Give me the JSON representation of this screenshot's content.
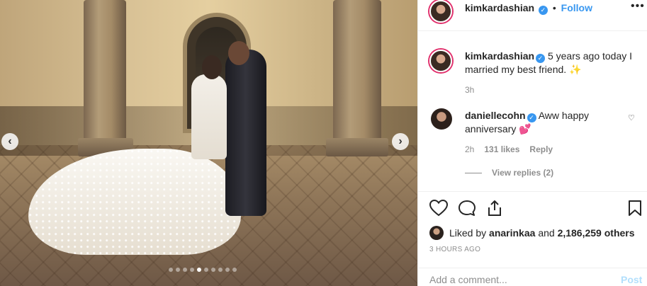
{
  "photo": {
    "prev_icon": "chevron-left-icon",
    "next_icon": "chevron-right-icon",
    "prev_glyph": "‹",
    "next_glyph": "›",
    "carousel_dot_count": 10,
    "active_dot_index": 4
  },
  "header": {
    "username": "kimkardashian",
    "separator": "•",
    "follow_label": "Follow",
    "more_glyph": "•••"
  },
  "caption": {
    "username": "kimkardashian",
    "text": "5 years ago today I married my best friend. ✨",
    "time": "3h"
  },
  "comment": {
    "username": "daniellecohn",
    "text": "Aww happy anniversary 💕",
    "time": "2h",
    "likes": "131 likes",
    "reply_label": "Reply",
    "view_replies": "View replies (2)",
    "like_glyph": "♡"
  },
  "actions": {
    "liked_by_prefix": "Liked by",
    "liked_by_user": "anarinkaa",
    "liked_by_and": "and",
    "liked_by_count": "2,186,259 others",
    "post_time": "3 HOURS AGO"
  },
  "add_comment": {
    "placeholder": "Add a comment...",
    "post_label": "Post"
  },
  "colors": {
    "link_blue": "#3897f0",
    "post_disabled": "#b2dffc",
    "muted": "#8e8e8e"
  }
}
